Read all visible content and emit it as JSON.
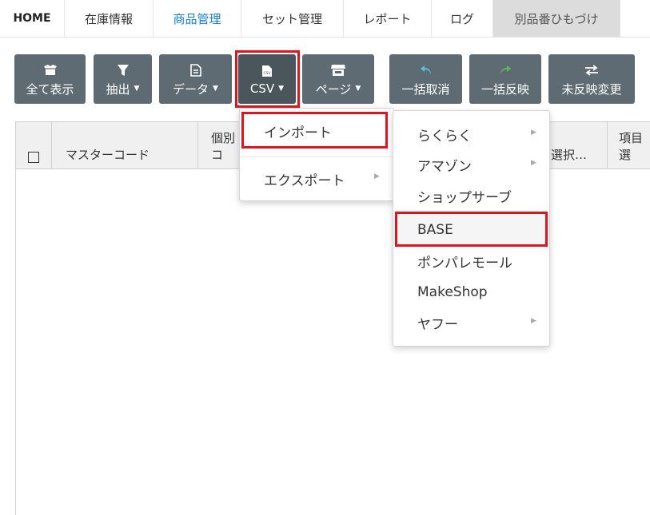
{
  "nav": {
    "tabs": [
      {
        "label": "HOME"
      },
      {
        "label": "在庫情報"
      },
      {
        "label": "商品管理"
      },
      {
        "label": "セット管理"
      },
      {
        "label": "レポート"
      },
      {
        "label": "ログ"
      },
      {
        "label": "別品番ひもづけ"
      }
    ],
    "active_color": "#1a7fd3"
  },
  "toolbar": {
    "show_all": {
      "label": "全て表示",
      "icon": "box-open-icon"
    },
    "extract": {
      "label": "抽出",
      "icon": "filter-icon"
    },
    "data": {
      "label": "データ",
      "icon": "document-icon"
    },
    "csv": {
      "label": "CSV",
      "icon": "csv-file-icon"
    },
    "page": {
      "label": "ページ",
      "icon": "store-icon"
    },
    "undo_all": {
      "label": "一括取消",
      "icon": "undo-icon"
    },
    "apply_all": {
      "label": "一括反映",
      "icon": "redo-icon"
    },
    "unapplied": {
      "label": "未反映変更",
      "icon": "exchange-icon"
    },
    "caret": "▼"
  },
  "grid": {
    "columns": [
      "マスターコード",
      "個別コ",
      "選択…",
      "項目選"
    ]
  },
  "csv_menu": {
    "items": [
      {
        "label": "インポート"
      },
      {
        "label": "エクスポート"
      }
    ]
  },
  "import_menu": {
    "items": [
      {
        "label": "らくらく"
      },
      {
        "label": "アマゾン"
      },
      {
        "label": "ショップサーブ"
      },
      {
        "label": "BASE"
      },
      {
        "label": "ポンパレモール"
      },
      {
        "label": "MakeShop"
      },
      {
        "label": "ヤフー"
      }
    ]
  },
  "colors": {
    "button_bg": "#5f6b73",
    "highlight": "#e0141e",
    "undo_icon": "#5bc0de",
    "redo_icon": "#5cb85c"
  }
}
